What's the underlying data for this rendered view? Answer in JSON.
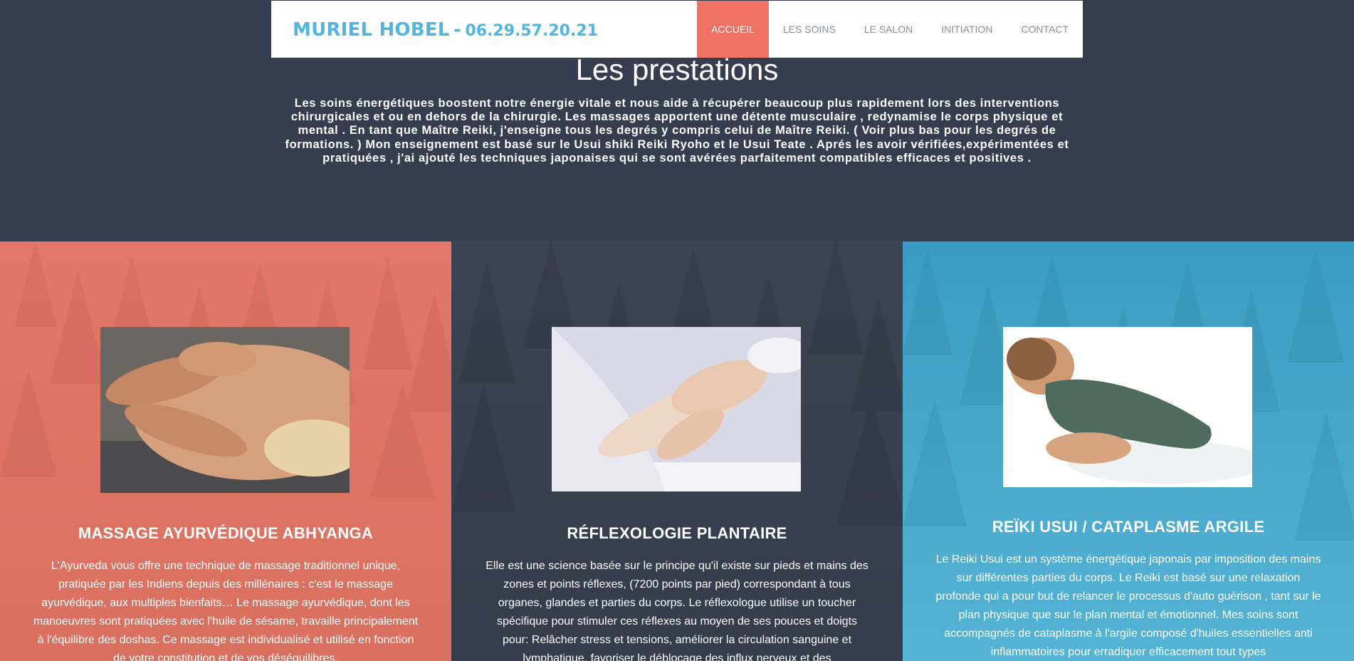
{
  "header": {
    "brand_name": "MURIEL HOBEL",
    "brand_separator": "-",
    "brand_phone": "06.29.57.20.21",
    "nav": [
      {
        "label": "ACCUEIL",
        "active": true
      },
      {
        "label": "LES SOINS",
        "active": false
      },
      {
        "label": "LE SALON",
        "active": false
      },
      {
        "label": "INITIATION",
        "active": false
      },
      {
        "label": "CONTACT",
        "active": false
      }
    ]
  },
  "intro": {
    "title": "Les prestations",
    "text": "Les soins énergétiques boostent notre énergie vitale et nous aide à récupérer beaucoup plus rapidement lors des interventions chirurgicales et ou en dehors de la chirurgie. Les massages apportent une détente musculaire , redynamise le corps physique et mental . En tant que Maître Reiki, j'enseigne tous les degrés y compris celui de Maître Reiki. ( Voir plus bas pour les degrés de formations. ) Mon enseignement est basé sur le Usui shiki Reiki Ryoho et le Usui Teate . Aprés les avoir vérifiées,expérimentées et pratiquées , j'ai ajouté les techniques japonaises qui se sont avérées parfaitement compatibles efficaces et positives ."
  },
  "services": [
    {
      "title": "MASSAGE AYURVÉDIQUE ABHYANGA",
      "text": "L'Ayurveda vous offre une technique de massage traditionnel unique, pratiquée par les Indiens depuis des millénaires : c'est le massage ayurvédique, aux multiples bienfaits… Le massage ayurvédique, dont les manoeuvres sont pratiquées avec l'huile de sésame, travaille principalement à l'équilibre des doshas. Ce massage est individualisé et utilisé en fonction de votre constitution et de vos déséquilibres.",
      "color": "#e2776a"
    },
    {
      "title": "RÉFLEXOLOGIE PLANTAIRE",
      "text": "Elle est une science basée sur le principe qu'il existe sur pieds et mains des zones et points réflexes, (7200 points par pied) correspondant à tous organes, glandes et parties du corps. Le réflexologue utilise un toucher spécifique pour stimuler ces réflexes au moyen de ses pouces et doigts pour: Relâcher stress et tensions, améliorer la circulation sanguine et lymphatique, favoriser le déblocage des influx nerveux et des",
      "color": "#3c4454"
    },
    {
      "title": "REÏKI USUI / CATAPLASME ARGILE",
      "text": "Le Reiki Usui est un système énergétique japonais par imposition des mains sur différentes parties du corps. Le Reiki est basé sur une relaxation profonde qui a pour but de relancer le processus d'auto guérison , tant sur le plan physique que sur le plan mental et émotionnel. Mes soins sont accompagnés de cataplasme à l'argile composé d'huiles essentielles anti inflammatoires pour erradiquer efficacement tout types",
      "color": "#3a9cc2"
    }
  ],
  "colors": {
    "background": "#363d4f",
    "accent": "#ef7264",
    "brand": "#4fb6e0"
  }
}
